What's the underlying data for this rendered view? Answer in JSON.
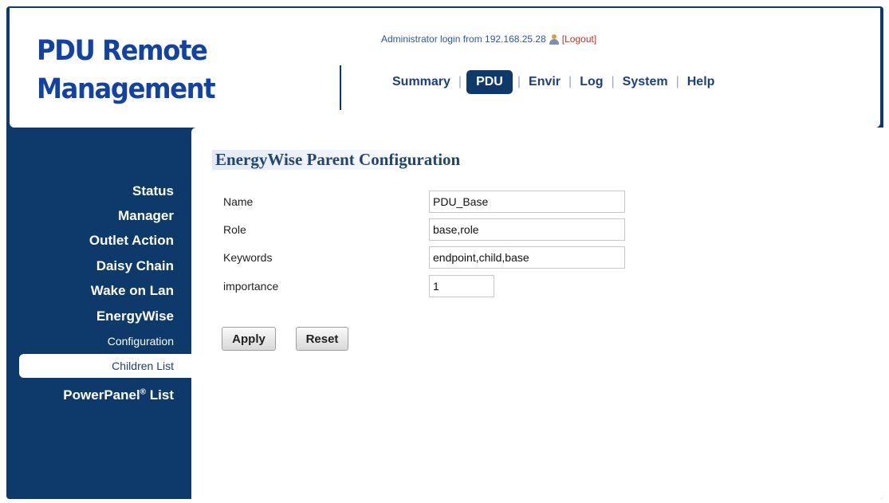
{
  "header": {
    "logo_line1": "PDU Remote",
    "logo_line2": "Management",
    "login_text": "Administrator login from 192.168.25.28",
    "logout_label": "[Logout]"
  },
  "nav": {
    "items": [
      {
        "label": "Summary"
      },
      {
        "label": "PDU",
        "active": true
      },
      {
        "label": "Envir"
      },
      {
        "label": "Log"
      },
      {
        "label": "System"
      },
      {
        "label": "Help"
      }
    ],
    "separator": "|"
  },
  "sidebar": {
    "items": [
      {
        "label": "Status"
      },
      {
        "label": "Manager"
      },
      {
        "label": "Outlet Action"
      },
      {
        "label": "Daisy Chain"
      },
      {
        "label": "Wake on Lan"
      },
      {
        "label": "EnergyWise"
      }
    ],
    "sub_items": [
      {
        "label": "Configuration"
      },
      {
        "label": "Children List",
        "selected": true
      }
    ],
    "powerpanel": {
      "label": "PowerPanel",
      "mark": "®",
      "suffix": " List"
    }
  },
  "content": {
    "title": "EnergyWise Parent Configuration",
    "fields": [
      {
        "label": "Name",
        "value": "PDU_Base"
      },
      {
        "label": "Role",
        "value": "base,role"
      },
      {
        "label": "Keywords",
        "value": "endpoint,child,base"
      },
      {
        "label": "importance",
        "value": "1"
      }
    ],
    "apply_label": "Apply",
    "reset_label": "Reset"
  },
  "colors": {
    "navy": "#0d3a6b",
    "logo_blue": "#1243a4",
    "logout_red": "#c03020"
  }
}
